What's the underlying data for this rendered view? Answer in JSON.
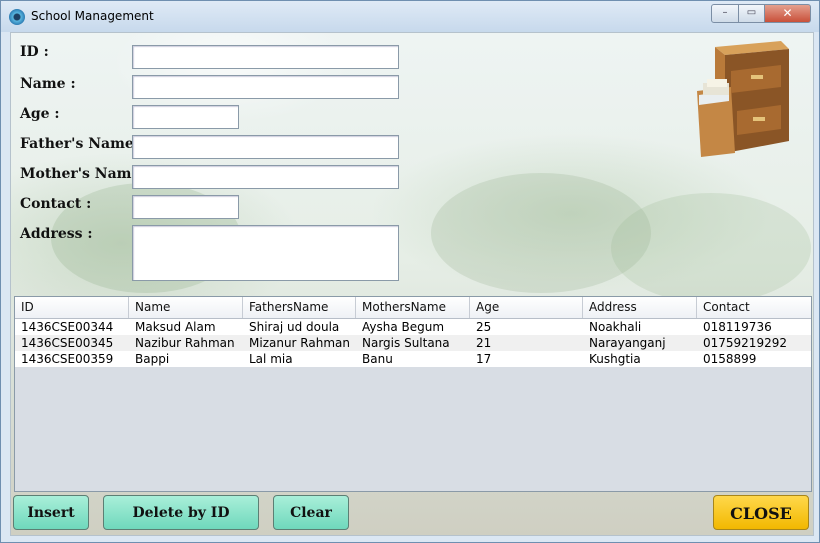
{
  "window": {
    "title": "School Management",
    "controls": {
      "minimize": "–",
      "maximize": "▭",
      "close": "✕"
    }
  },
  "form": {
    "id_label": "ID :",
    "name_label": "Name :",
    "age_label": "Age :",
    "father_label": "Father's Name :",
    "mother_label": "Mother's Name :",
    "contact_label": "Contact :",
    "address_label": "Address :",
    "id_value": "",
    "name_value": "",
    "age_value": "",
    "father_value": "",
    "mother_value": "",
    "contact_value": "",
    "address_value": ""
  },
  "table": {
    "columns": [
      "ID",
      "Name",
      "FathersName",
      "MothersName",
      "Age",
      "Address",
      "Contact"
    ],
    "rows": [
      [
        "1436CSE00344",
        "Maksud Alam",
        "Shiraj ud doula",
        "Aysha Begum",
        "25",
        "Noakhali",
        "018119736"
      ],
      [
        "1436CSE00345",
        "Nazibur Rahman",
        "Mizanur Rahman",
        "Nargis Sultana",
        "21",
        "Narayanganj",
        "01759219292"
      ],
      [
        "1436CSE00359",
        "Bappi",
        "Lal mia",
        "Banu",
        "17",
        "Kushgtia",
        "0158899"
      ]
    ]
  },
  "buttons": {
    "insert": "Insert",
    "delete": "Delete by ID",
    "clear": "Clear",
    "close": "CLOSE"
  },
  "icons": {
    "app_icon": "app-icon",
    "cabinet_icon": "file-cabinet-icon"
  }
}
